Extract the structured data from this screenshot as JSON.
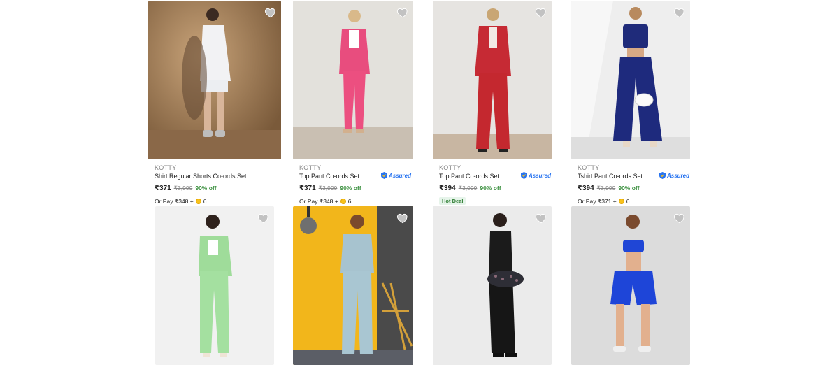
{
  "products": [
    {
      "brand": "KOTTY",
      "title": "Shirt Regular Shorts Co-ords Set",
      "price": "₹371",
      "mrp": "₹3,999",
      "discount": "90% off",
      "pay_prefix": "Or Pay ₹348 +",
      "coins": "6",
      "assured": false,
      "hot_deal": false
    },
    {
      "brand": "KOTTY",
      "title": "Top Pant Co-ords Set",
      "price": "₹371",
      "mrp": "₹3,999",
      "discount": "90% off",
      "pay_prefix": "Or Pay ₹348 +",
      "coins": "6",
      "assured": true,
      "hot_deal": false
    },
    {
      "brand": "KOTTY",
      "title": "Top Pant Co-ords Set",
      "price": "₹394",
      "mrp": "₹3,999",
      "discount": "90% off",
      "pay_prefix": "",
      "coins": "",
      "assured": true,
      "hot_deal": true
    },
    {
      "brand": "KOTTY",
      "title": "Tshirt Pant Co-ords Set",
      "price": "₹394",
      "mrp": "₹3,999",
      "discount": "90% off",
      "pay_prefix": "Or Pay ₹371 +",
      "coins": "6",
      "assured": true,
      "hot_deal": false
    }
  ],
  "labels": {
    "assured": "Assured",
    "hot_deal": "Hot Deal"
  },
  "icons": {
    "wishlist": "heart-icon",
    "assured_badge": "shield-icon",
    "coin": "supercoin-icon"
  },
  "colors": {
    "discount": "#388e3c",
    "assured": "#2874f0",
    "hot_deal_bg": "#e6f4ea"
  }
}
